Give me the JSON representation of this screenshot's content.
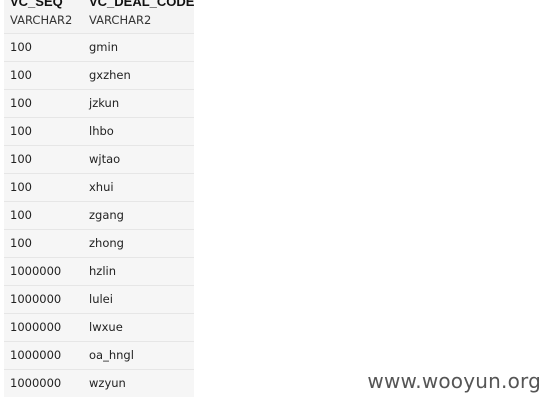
{
  "columns": [
    {
      "name": "VC_SEQ",
      "type": "VARCHAR2"
    },
    {
      "name": "VC_DEAL_CODE",
      "type": "VARCHAR2"
    }
  ],
  "rows": [
    [
      "100",
      "gmin"
    ],
    [
      "100",
      "gxzhen"
    ],
    [
      "100",
      "jzkun"
    ],
    [
      "100",
      "lhbo"
    ],
    [
      "100",
      "wjtao"
    ],
    [
      "100",
      "xhui"
    ],
    [
      "100",
      "zgang"
    ],
    [
      "100",
      "zhong"
    ],
    [
      "1000000",
      "hzlin"
    ],
    [
      "1000000",
      "lulei"
    ],
    [
      "1000000",
      "lwxue"
    ],
    [
      "1000000",
      "oa_hngl"
    ],
    [
      "1000000",
      "wzyun"
    ]
  ],
  "watermark": "www.wooyun.org",
  "colors": {
    "row_background": "#f6f6f6",
    "row_border": "#e6e6e6",
    "header_background": "#f4f4f4",
    "page_background": "#ffffff"
  }
}
